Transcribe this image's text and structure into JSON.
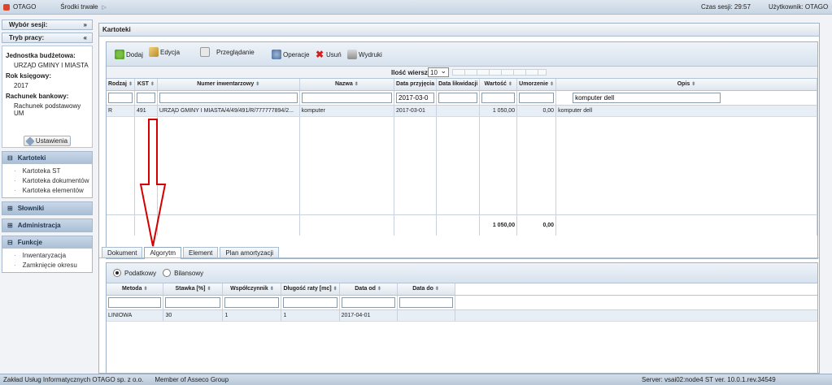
{
  "topbar": {
    "app": "OTAGO",
    "module": "Środki trwałe",
    "session_label": "Czas sesji:",
    "session_time": "29:57",
    "user_label": "Użytkownik:",
    "user": "OTAGO"
  },
  "sidebar": {
    "session_choice": "Wybór sesji:",
    "work_mode": "Tryb pracy:",
    "unit_label": "Jednostka budżetowa:",
    "unit_value": "URZĄD GMINY I MIASTA",
    "year_label": "Rok księgowy:",
    "year_value": "2017",
    "account_label": "Rachunek bankowy:",
    "account_value": "Rachunek podstawowy UM",
    "settings_button": "Ustawienia",
    "sections": [
      {
        "title": "Kartoteki",
        "items": [
          "Kartoteka ST",
          "Kartoteka dokumentów",
          "Kartoteka elementów"
        ]
      },
      {
        "title": "Słowniki",
        "items": []
      },
      {
        "title": "Administracja",
        "items": []
      },
      {
        "title": "Funkcje",
        "items": [
          "Inwentaryzacja",
          "Zamknięcie okresu"
        ]
      }
    ]
  },
  "panel_title": "Kartoteki",
  "toolbar": {
    "add": "Dodaj",
    "edit": "Edycja",
    "view": "Przeglądanie",
    "operations": "Operacje",
    "delete": "Usuń",
    "print": "Wydruki"
  },
  "pager": {
    "label": "Ilość wierszy",
    "value": "10"
  },
  "grid": {
    "columns": [
      "Rodzaj",
      "KST",
      "Numer inwentarzowy",
      "Nazwa",
      "Data przyjęcia",
      "Data likwidacji",
      "Wartość",
      "Umorzenie",
      "Opis"
    ],
    "filters": {
      "data_przyjecia": "2017-03-0",
      "opis": "komputer dell"
    },
    "row": {
      "rodzaj": "R",
      "kst": "491",
      "numer": "URZĄD GMINY I MIASTA/4/49/491/R/777777894/2...",
      "nazwa": "komputer",
      "data_przyjecia": "2017-03-01",
      "data_likwidacji": "",
      "wartosc": "1 050,00",
      "umorzenie": "0,00",
      "opis": "komputer dell"
    },
    "sum": {
      "wartosc": "1 050,00",
      "umorzenie": "0,00"
    }
  },
  "tabs": [
    "Dokument",
    "Algorytm",
    "Element",
    "Plan amortyzacji"
  ],
  "detail": {
    "radio_tax": "Podatkowy",
    "radio_balance": "Bilansowy",
    "columns": [
      "Metoda",
      "Stawka [%]",
      "Współczynnik",
      "Długość raty [mc]",
      "Data od",
      "Data do"
    ],
    "row": {
      "metoda": "LINIOWA",
      "stawka": "30",
      "wspolczynnik": "1",
      "dlugosc": "1",
      "data_od": "2017-04-01",
      "data_do": ""
    }
  },
  "footer": {
    "company": "Zakład Usług Informatycznych OTAGO sp. z o.o.",
    "member": "Member of Asseco Group",
    "server": "Server: vsai02:node4 ST ver. 10.0.1.rev.34549"
  },
  "colors": {
    "accent": "#a9bfd6",
    "arrow": "#d40000"
  }
}
